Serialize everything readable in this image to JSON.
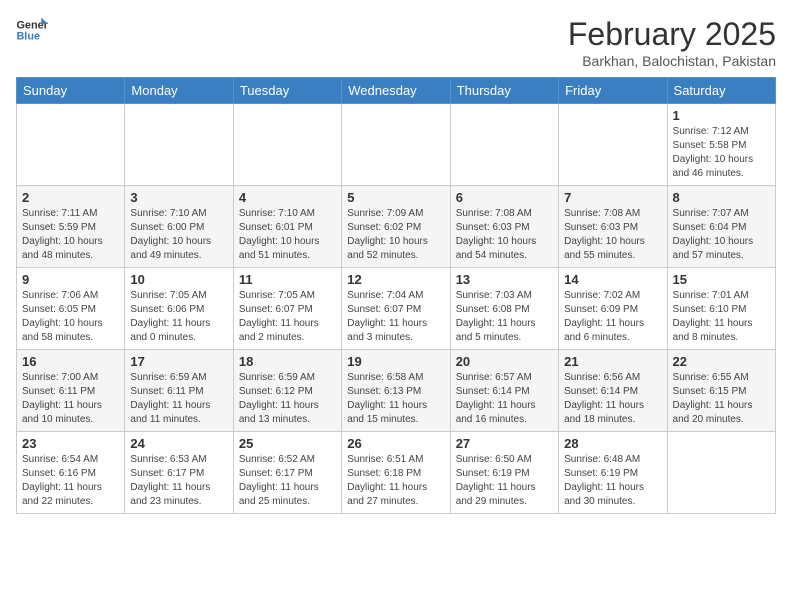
{
  "header": {
    "logo_general": "General",
    "logo_blue": "Blue",
    "title": "February 2025",
    "subtitle": "Barkhan, Balochistan, Pakistan"
  },
  "weekdays": [
    "Sunday",
    "Monday",
    "Tuesday",
    "Wednesday",
    "Thursday",
    "Friday",
    "Saturday"
  ],
  "weeks": [
    [
      {
        "day": "",
        "info": ""
      },
      {
        "day": "",
        "info": ""
      },
      {
        "day": "",
        "info": ""
      },
      {
        "day": "",
        "info": ""
      },
      {
        "day": "",
        "info": ""
      },
      {
        "day": "",
        "info": ""
      },
      {
        "day": "1",
        "info": "Sunrise: 7:12 AM\nSunset: 5:58 PM\nDaylight: 10 hours and 46 minutes."
      }
    ],
    [
      {
        "day": "2",
        "info": "Sunrise: 7:11 AM\nSunset: 5:59 PM\nDaylight: 10 hours and 48 minutes."
      },
      {
        "day": "3",
        "info": "Sunrise: 7:10 AM\nSunset: 6:00 PM\nDaylight: 10 hours and 49 minutes."
      },
      {
        "day": "4",
        "info": "Sunrise: 7:10 AM\nSunset: 6:01 PM\nDaylight: 10 hours and 51 minutes."
      },
      {
        "day": "5",
        "info": "Sunrise: 7:09 AM\nSunset: 6:02 PM\nDaylight: 10 hours and 52 minutes."
      },
      {
        "day": "6",
        "info": "Sunrise: 7:08 AM\nSunset: 6:03 PM\nDaylight: 10 hours and 54 minutes."
      },
      {
        "day": "7",
        "info": "Sunrise: 7:08 AM\nSunset: 6:03 PM\nDaylight: 10 hours and 55 minutes."
      },
      {
        "day": "8",
        "info": "Sunrise: 7:07 AM\nSunset: 6:04 PM\nDaylight: 10 hours and 57 minutes."
      }
    ],
    [
      {
        "day": "9",
        "info": "Sunrise: 7:06 AM\nSunset: 6:05 PM\nDaylight: 10 hours and 58 minutes."
      },
      {
        "day": "10",
        "info": "Sunrise: 7:05 AM\nSunset: 6:06 PM\nDaylight: 11 hours and 0 minutes."
      },
      {
        "day": "11",
        "info": "Sunrise: 7:05 AM\nSunset: 6:07 PM\nDaylight: 11 hours and 2 minutes."
      },
      {
        "day": "12",
        "info": "Sunrise: 7:04 AM\nSunset: 6:07 PM\nDaylight: 11 hours and 3 minutes."
      },
      {
        "day": "13",
        "info": "Sunrise: 7:03 AM\nSunset: 6:08 PM\nDaylight: 11 hours and 5 minutes."
      },
      {
        "day": "14",
        "info": "Sunrise: 7:02 AM\nSunset: 6:09 PM\nDaylight: 11 hours and 6 minutes."
      },
      {
        "day": "15",
        "info": "Sunrise: 7:01 AM\nSunset: 6:10 PM\nDaylight: 11 hours and 8 minutes."
      }
    ],
    [
      {
        "day": "16",
        "info": "Sunrise: 7:00 AM\nSunset: 6:11 PM\nDaylight: 11 hours and 10 minutes."
      },
      {
        "day": "17",
        "info": "Sunrise: 6:59 AM\nSunset: 6:11 PM\nDaylight: 11 hours and 11 minutes."
      },
      {
        "day": "18",
        "info": "Sunrise: 6:59 AM\nSunset: 6:12 PM\nDaylight: 11 hours and 13 minutes."
      },
      {
        "day": "19",
        "info": "Sunrise: 6:58 AM\nSunset: 6:13 PM\nDaylight: 11 hours and 15 minutes."
      },
      {
        "day": "20",
        "info": "Sunrise: 6:57 AM\nSunset: 6:14 PM\nDaylight: 11 hours and 16 minutes."
      },
      {
        "day": "21",
        "info": "Sunrise: 6:56 AM\nSunset: 6:14 PM\nDaylight: 11 hours and 18 minutes."
      },
      {
        "day": "22",
        "info": "Sunrise: 6:55 AM\nSunset: 6:15 PM\nDaylight: 11 hours and 20 minutes."
      }
    ],
    [
      {
        "day": "23",
        "info": "Sunrise: 6:54 AM\nSunset: 6:16 PM\nDaylight: 11 hours and 22 minutes."
      },
      {
        "day": "24",
        "info": "Sunrise: 6:53 AM\nSunset: 6:17 PM\nDaylight: 11 hours and 23 minutes."
      },
      {
        "day": "25",
        "info": "Sunrise: 6:52 AM\nSunset: 6:17 PM\nDaylight: 11 hours and 25 minutes."
      },
      {
        "day": "26",
        "info": "Sunrise: 6:51 AM\nSunset: 6:18 PM\nDaylight: 11 hours and 27 minutes."
      },
      {
        "day": "27",
        "info": "Sunrise: 6:50 AM\nSunset: 6:19 PM\nDaylight: 11 hours and 29 minutes."
      },
      {
        "day": "28",
        "info": "Sunrise: 6:48 AM\nSunset: 6:19 PM\nDaylight: 11 hours and 30 minutes."
      },
      {
        "day": "",
        "info": ""
      }
    ]
  ]
}
